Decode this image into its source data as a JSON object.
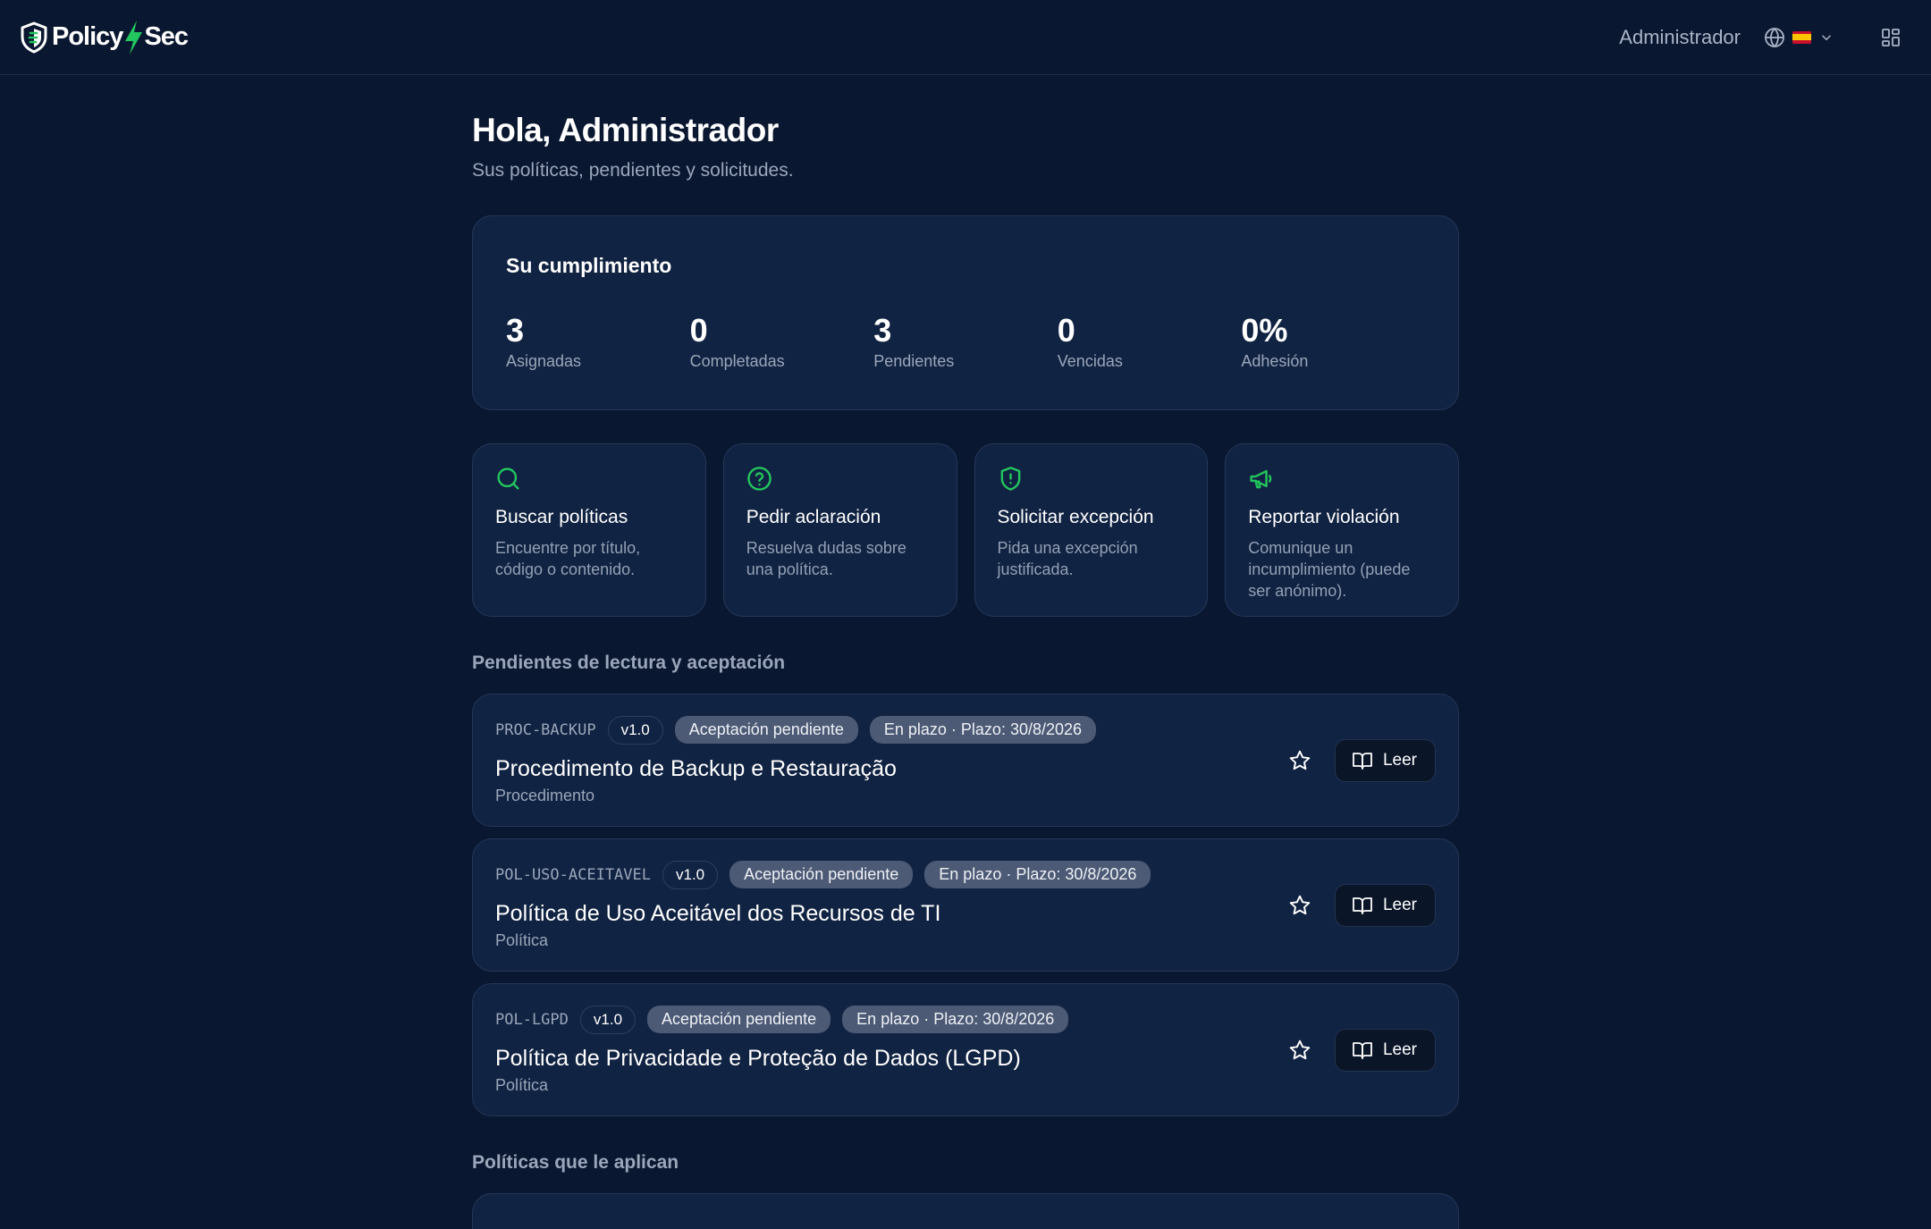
{
  "header": {
    "logo_part1": "Policy",
    "logo_part2": "Sec",
    "user_name": "Administrador",
    "language_flag": "es"
  },
  "greeting": {
    "title": "Hola, Administrador",
    "subtitle": "Sus políticas, pendientes y solicitudes."
  },
  "compliance": {
    "title": "Su cumplimiento",
    "stats": [
      {
        "value": "3",
        "label": "Asignadas"
      },
      {
        "value": "0",
        "label": "Completadas"
      },
      {
        "value": "3",
        "label": "Pendientes"
      },
      {
        "value": "0",
        "label": "Vencidas"
      },
      {
        "value": "0%",
        "label": "Adhesión"
      }
    ]
  },
  "actions": [
    {
      "icon": "search-icon",
      "title": "Buscar políticas",
      "desc": "Encuentre por título, código o contenido."
    },
    {
      "icon": "help-circle-icon",
      "title": "Pedir aclaración",
      "desc": "Resuelva dudas sobre una política."
    },
    {
      "icon": "shield-alert-icon",
      "title": "Solicitar excepción",
      "desc": "Pida una excepción justificada."
    },
    {
      "icon": "megaphone-icon",
      "title": "Reportar violación",
      "desc": "Comunique un incumplimiento (puede ser anónimo)."
    }
  ],
  "pending": {
    "section_title": "Pendientes de lectura y aceptación",
    "items": [
      {
        "code": "PROC-BACKUP",
        "version": "v1.0",
        "status": "Aceptación pendiente",
        "deadline": "En plazo · Plazo: 30/8/2026",
        "title": "Procedimento de Backup e Restauração",
        "type": "Procedimento",
        "read_label": "Leer"
      },
      {
        "code": "POL-USO-ACEITAVEL",
        "version": "v1.0",
        "status": "Aceptación pendiente",
        "deadline": "En plazo · Plazo: 30/8/2026",
        "title": "Política de Uso Aceitável dos Recursos de TI",
        "type": "Política",
        "read_label": "Leer"
      },
      {
        "code": "POL-LGPD",
        "version": "v1.0",
        "status": "Aceptación pendiente",
        "deadline": "En plazo · Plazo: 30/8/2026",
        "title": "Política de Privacidade e Proteção de Dados (LGPD)",
        "type": "Política",
        "read_label": "Leer"
      }
    ]
  },
  "applicable": {
    "section_title": "Políticas que le aplican"
  },
  "colors": {
    "background": "#0a1730",
    "card": "#112342",
    "accent_green": "#22c55e",
    "badge_gray": "#4d5a75"
  }
}
